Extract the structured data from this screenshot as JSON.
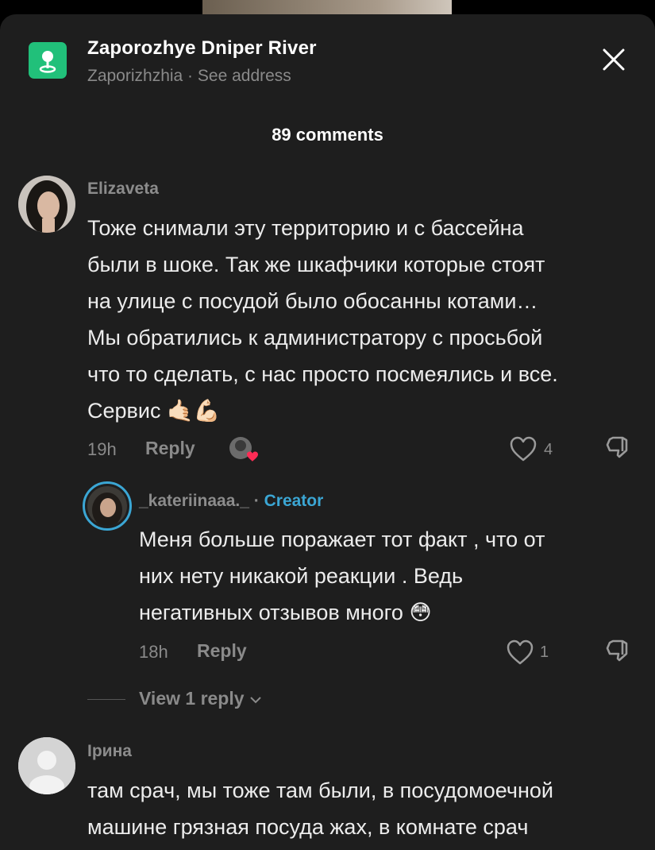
{
  "location": {
    "title": "Zaporozhye Dniper River",
    "subtitle": "Zaporizhzhia · See address"
  },
  "comments_header": "89 comments",
  "colors": {
    "sheet_bg": "#1e1e1e",
    "accent_green": "#21c07a",
    "creator_blue": "#3ba6d4",
    "muted": "#8a8a8a"
  },
  "comments": [
    {
      "username": "Elizaveta",
      "lines": [
        "Тоже снимали эту территорию и с бассейна",
        "были в шоке. Так же шкафчики которые стоят",
        "на улице с посудой было обосанны котами…",
        "Мы обратились к администратору с просьбой",
        "что то сделать, с нас просто посмеялись и все.",
        "Сервис 🤙🏻💪🏻"
      ],
      "time": "19h",
      "reply_label": "Reply",
      "likes": "4"
    },
    {
      "username": "_kateriinaaa._",
      "creator_sep": " · ",
      "creator_label": "Creator",
      "lines": [
        "Меня больше поражает тот факт , что от",
        "них нету никакой реакции . Ведь",
        "негативных отзывов много 😳"
      ],
      "time": "18h",
      "reply_label": "Reply",
      "likes": "1"
    },
    {
      "username": "Ірина",
      "lines": [
        "там срач, мы тоже там были, в посудомоечной",
        "машине грязная посуда жах, в комнате срач"
      ]
    }
  ],
  "view_replies_label": "View 1 reply"
}
